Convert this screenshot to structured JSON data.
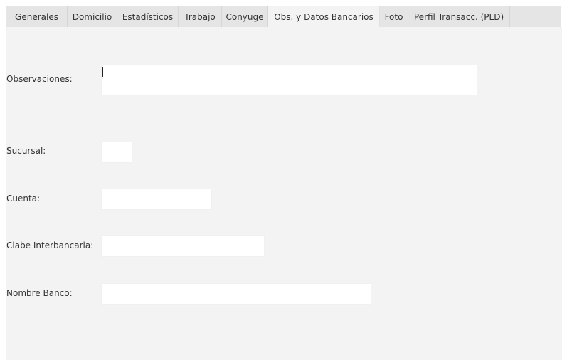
{
  "tabs": [
    {
      "label": "Generales",
      "active": false
    },
    {
      "label": "Domicilio",
      "active": false
    },
    {
      "label": "Estadísticos",
      "active": false
    },
    {
      "label": "Trabajo",
      "active": false
    },
    {
      "label": "Conyuge",
      "active": false
    },
    {
      "label": "Obs. y Datos Bancarios",
      "active": true
    },
    {
      "label": "Foto",
      "active": false
    },
    {
      "label": "Perfil Transacc. (PLD)",
      "active": false
    }
  ],
  "form": {
    "observaciones_label": "Observaciones:",
    "observaciones_value": "",
    "sucursal_label": "Sucursal:",
    "sucursal_value": "",
    "cuenta_label": "Cuenta:",
    "cuenta_value": "",
    "clabe_label": "Clabe Interbancaria:",
    "clabe_value": "",
    "banco_label": "Nombre Banco:",
    "banco_value": ""
  }
}
